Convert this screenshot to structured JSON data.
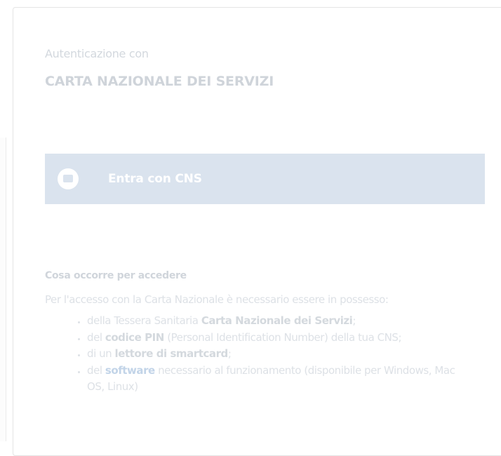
{
  "auth": {
    "prefix": "Autenticazione con",
    "title": "CARTA NAZIONALE DEI SERVIZI"
  },
  "login_button": {
    "label": "Entra con CNS",
    "icon": "smartcard-icon"
  },
  "requirements": {
    "heading": "Cosa occorre per accedere",
    "intro": "Per l'accesso con la Carta Nazionale è necessario essere in possesso:",
    "items": [
      {
        "before": "della Tessera Sanitaria ",
        "strong": "Carta Nazionale dei Servizi",
        "after": ";"
      },
      {
        "before": "del ",
        "strong": "codice PIN",
        "after": " (Personal Identification Number) della tua CNS;"
      },
      {
        "before": "di un ",
        "strong": "lettore di smartcard",
        "after": ";"
      },
      {
        "before": "del ",
        "link": "software",
        "after": " necessario al funzionamento (disponibile per Windows, Mac OS, Linux)"
      }
    ]
  },
  "colors": {
    "button_bg": "#dae3ee",
    "text_faint": "#dde1e6",
    "link": "#c2d4e8"
  }
}
